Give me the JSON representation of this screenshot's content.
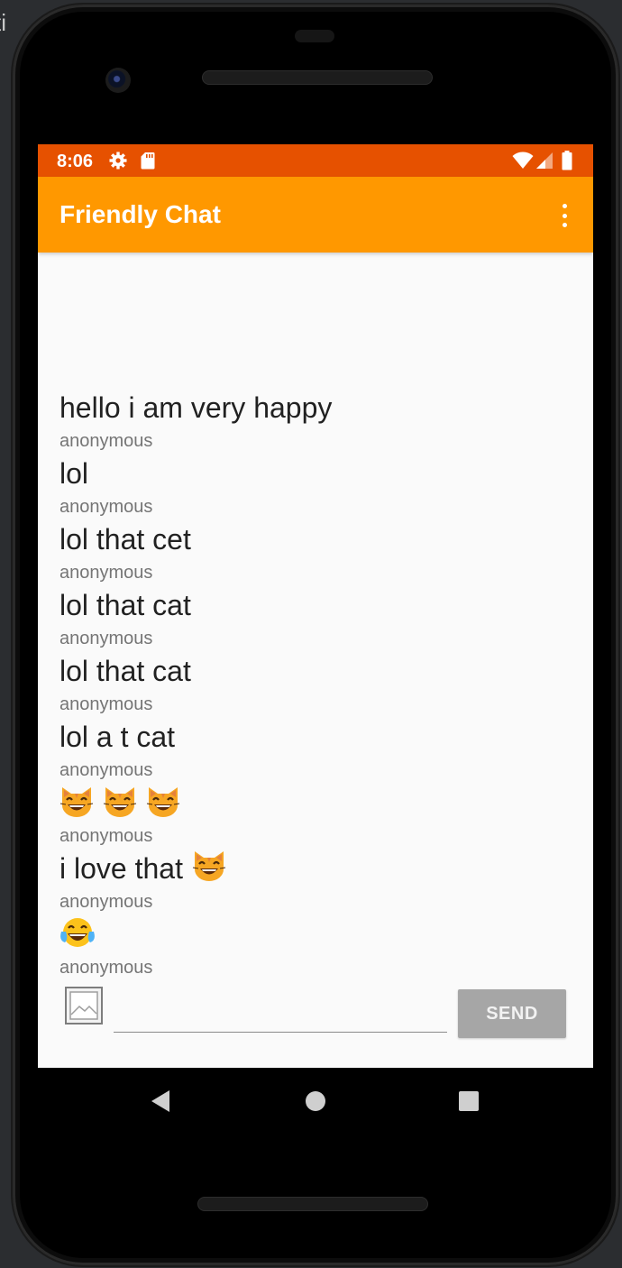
{
  "status_bar": {
    "time": "8:06",
    "icons": [
      "gear-icon",
      "sd-card-icon",
      "wifi-icon",
      "signal-icon",
      "battery-icon"
    ],
    "color": "#e65100"
  },
  "app_bar": {
    "title": "Friendly Chat",
    "color": "#ff9800",
    "menu_icon": "overflow-menu-icon"
  },
  "messages": [
    {
      "text": "hello i am very happy",
      "emojis": [],
      "author": "anonymous"
    },
    {
      "text": "lol",
      "emojis": [],
      "author": "anonymous"
    },
    {
      "text": "lol that cet",
      "emojis": [],
      "author": "anonymous"
    },
    {
      "text": "lol that cat",
      "emojis": [],
      "author": "anonymous"
    },
    {
      "text": "lol that cat",
      "emojis": [],
      "author": "anonymous"
    },
    {
      "text": "lol a t cat",
      "emojis": [],
      "author": "anonymous"
    },
    {
      "text": "",
      "emojis": [
        "grinning-cat-emoji",
        "grinning-cat-emoji",
        "grinning-cat-emoji"
      ],
      "author": "anonymous"
    },
    {
      "text": "i love that",
      "emojis": [
        "grinning-cat-emoji"
      ],
      "author": "anonymous"
    },
    {
      "text": "",
      "emojis": [
        "tears-of-joy-emoji"
      ],
      "author": "anonymous"
    }
  ],
  "composer": {
    "photo_picker_icon": "image-icon",
    "input_value": "",
    "input_placeholder": "",
    "send_label": "SEND"
  },
  "nav_bar": {
    "icons": [
      "back-icon",
      "home-icon",
      "recents-icon"
    ]
  }
}
